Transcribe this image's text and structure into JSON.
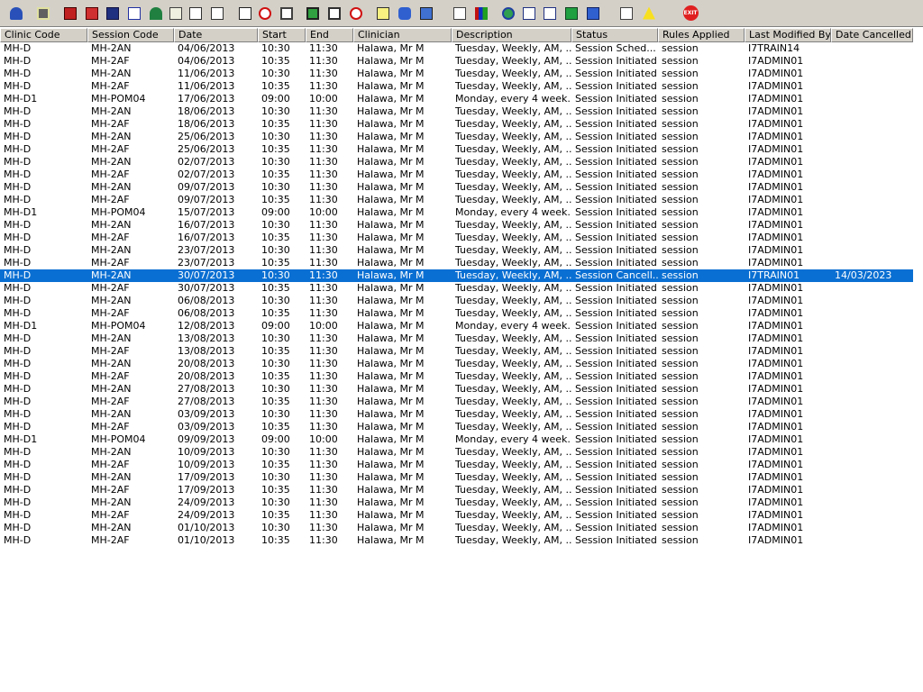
{
  "toolbar": {
    "icons": [
      "user-icon",
      "print-icon",
      "book-icon",
      "folder-icon",
      "report-icon",
      "m-icon",
      "person-icon",
      "notes-icon",
      "transfer-icon",
      "ticket-icon",
      "document-search-icon",
      "cancel-circle-icon",
      "window-icon",
      "monitor-icon",
      "list-icon",
      "clock-icon",
      "edit-icon",
      "car-icon",
      "upload-icon",
      "page-icon",
      "bar-chart-icon",
      "globe-icon",
      "check-list-icon",
      "check-list-2-icon",
      "export-icon",
      "import-icon",
      "swap-icon",
      "warning-icon",
      "exit-icon"
    ],
    "exit_label": "EXIT"
  },
  "columns": [
    "Clinic Code",
    "Session Code",
    "Date",
    "Start",
    "End",
    "Clinician",
    "Description",
    "Status",
    "Rules Applied",
    "Last Modified By",
    "Date Cancelled"
  ],
  "rows": [
    [
      "MH-D",
      "MH-2AN",
      "04/06/2013",
      "10:30",
      "11:30",
      "Halawa, Mr M",
      "Tuesday, Weekly, AM, ...",
      "Session Sched...",
      "session",
      "I7TRAIN14",
      ""
    ],
    [
      "MH-D",
      "MH-2AF",
      "04/06/2013",
      "10:35",
      "11:30",
      "Halawa, Mr M",
      "Tuesday, Weekly, AM, ...",
      "Session Initiated",
      "session",
      "I7ADMIN01",
      ""
    ],
    [
      "MH-D",
      "MH-2AN",
      "11/06/2013",
      "10:30",
      "11:30",
      "Halawa, Mr M",
      "Tuesday, Weekly, AM, ...",
      "Session Initiated",
      "session",
      "I7ADMIN01",
      ""
    ],
    [
      "MH-D",
      "MH-2AF",
      "11/06/2013",
      "10:35",
      "11:30",
      "Halawa, Mr M",
      "Tuesday, Weekly, AM, ...",
      "Session Initiated",
      "session",
      "I7ADMIN01",
      ""
    ],
    [
      "MH-D1",
      "MH-POM04",
      "17/06/2013",
      "09:00",
      "10:00",
      "Halawa, Mr M",
      "Monday, every 4 week...",
      "Session Initiated",
      "session",
      "I7ADMIN01",
      ""
    ],
    [
      "MH-D",
      "MH-2AN",
      "18/06/2013",
      "10:30",
      "11:30",
      "Halawa, Mr M",
      "Tuesday, Weekly, AM, ...",
      "Session Initiated",
      "session",
      "I7ADMIN01",
      ""
    ],
    [
      "MH-D",
      "MH-2AF",
      "18/06/2013",
      "10:35",
      "11:30",
      "Halawa, Mr M",
      "Tuesday, Weekly, AM, ...",
      "Session Initiated",
      "session",
      "I7ADMIN01",
      ""
    ],
    [
      "MH-D",
      "MH-2AN",
      "25/06/2013",
      "10:30",
      "11:30",
      "Halawa, Mr M",
      "Tuesday, Weekly, AM, ...",
      "Session Initiated",
      "session",
      "I7ADMIN01",
      ""
    ],
    [
      "MH-D",
      "MH-2AF",
      "25/06/2013",
      "10:35",
      "11:30",
      "Halawa, Mr M",
      "Tuesday, Weekly, AM, ...",
      "Session Initiated",
      "session",
      "I7ADMIN01",
      ""
    ],
    [
      "MH-D",
      "MH-2AN",
      "02/07/2013",
      "10:30",
      "11:30",
      "Halawa, Mr M",
      "Tuesday, Weekly, AM, ...",
      "Session Initiated",
      "session",
      "I7ADMIN01",
      ""
    ],
    [
      "MH-D",
      "MH-2AF",
      "02/07/2013",
      "10:35",
      "11:30",
      "Halawa, Mr M",
      "Tuesday, Weekly, AM, ...",
      "Session Initiated",
      "session",
      "I7ADMIN01",
      ""
    ],
    [
      "MH-D",
      "MH-2AN",
      "09/07/2013",
      "10:30",
      "11:30",
      "Halawa, Mr M",
      "Tuesday, Weekly, AM, ...",
      "Session Initiated",
      "session",
      "I7ADMIN01",
      ""
    ],
    [
      "MH-D",
      "MH-2AF",
      "09/07/2013",
      "10:35",
      "11:30",
      "Halawa, Mr M",
      "Tuesday, Weekly, AM, ...",
      "Session Initiated",
      "session",
      "I7ADMIN01",
      ""
    ],
    [
      "MH-D1",
      "MH-POM04",
      "15/07/2013",
      "09:00",
      "10:00",
      "Halawa, Mr M",
      "Monday, every 4 week...",
      "Session Initiated",
      "session",
      "I7ADMIN01",
      ""
    ],
    [
      "MH-D",
      "MH-2AN",
      "16/07/2013",
      "10:30",
      "11:30",
      "Halawa, Mr M",
      "Tuesday, Weekly, AM, ...",
      "Session Initiated",
      "session",
      "I7ADMIN01",
      ""
    ],
    [
      "MH-D",
      "MH-2AF",
      "16/07/2013",
      "10:35",
      "11:30",
      "Halawa, Mr M",
      "Tuesday, Weekly, AM, ...",
      "Session Initiated",
      "session",
      "I7ADMIN01",
      ""
    ],
    [
      "MH-D",
      "MH-2AN",
      "23/07/2013",
      "10:30",
      "11:30",
      "Halawa, Mr M",
      "Tuesday, Weekly, AM, ...",
      "Session Initiated",
      "session",
      "I7ADMIN01",
      ""
    ],
    [
      "MH-D",
      "MH-2AF",
      "23/07/2013",
      "10:35",
      "11:30",
      "Halawa, Mr M",
      "Tuesday, Weekly, AM, ...",
      "Session Initiated",
      "session",
      "I7ADMIN01",
      ""
    ],
    [
      "MH-D",
      "MH-2AN",
      "30/07/2013",
      "10:30",
      "11:30",
      "Halawa, Mr M",
      "Tuesday, Weekly, AM, ...",
      "Session Cancell...",
      "session",
      "I7TRAIN01",
      "14/03/2023"
    ],
    [
      "MH-D",
      "MH-2AF",
      "30/07/2013",
      "10:35",
      "11:30",
      "Halawa, Mr M",
      "Tuesday, Weekly, AM, ...",
      "Session Initiated",
      "session",
      "I7ADMIN01",
      ""
    ],
    [
      "MH-D",
      "MH-2AN",
      "06/08/2013",
      "10:30",
      "11:30",
      "Halawa, Mr M",
      "Tuesday, Weekly, AM, ...",
      "Session Initiated",
      "session",
      "I7ADMIN01",
      ""
    ],
    [
      "MH-D",
      "MH-2AF",
      "06/08/2013",
      "10:35",
      "11:30",
      "Halawa, Mr M",
      "Tuesday, Weekly, AM, ...",
      "Session Initiated",
      "session",
      "I7ADMIN01",
      ""
    ],
    [
      "MH-D1",
      "MH-POM04",
      "12/08/2013",
      "09:00",
      "10:00",
      "Halawa, Mr M",
      "Monday, every 4 week...",
      "Session Initiated",
      "session",
      "I7ADMIN01",
      ""
    ],
    [
      "MH-D",
      "MH-2AN",
      "13/08/2013",
      "10:30",
      "11:30",
      "Halawa, Mr M",
      "Tuesday, Weekly, AM, ...",
      "Session Initiated",
      "session",
      "I7ADMIN01",
      ""
    ],
    [
      "MH-D",
      "MH-2AF",
      "13/08/2013",
      "10:35",
      "11:30",
      "Halawa, Mr M",
      "Tuesday, Weekly, AM, ...",
      "Session Initiated",
      "session",
      "I7ADMIN01",
      ""
    ],
    [
      "MH-D",
      "MH-2AN",
      "20/08/2013",
      "10:30",
      "11:30",
      "Halawa, Mr M",
      "Tuesday, Weekly, AM, ...",
      "Session Initiated",
      "session",
      "I7ADMIN01",
      ""
    ],
    [
      "MH-D",
      "MH-2AF",
      "20/08/2013",
      "10:35",
      "11:30",
      "Halawa, Mr M",
      "Tuesday, Weekly, AM, ...",
      "Session Initiated",
      "session",
      "I7ADMIN01",
      ""
    ],
    [
      "MH-D",
      "MH-2AN",
      "27/08/2013",
      "10:30",
      "11:30",
      "Halawa, Mr M",
      "Tuesday, Weekly, AM, ...",
      "Session Initiated",
      "session",
      "I7ADMIN01",
      ""
    ],
    [
      "MH-D",
      "MH-2AF",
      "27/08/2013",
      "10:35",
      "11:30",
      "Halawa, Mr M",
      "Tuesday, Weekly, AM, ...",
      "Session Initiated",
      "session",
      "I7ADMIN01",
      ""
    ],
    [
      "MH-D",
      "MH-2AN",
      "03/09/2013",
      "10:30",
      "11:30",
      "Halawa, Mr M",
      "Tuesday, Weekly, AM, ...",
      "Session Initiated",
      "session",
      "I7ADMIN01",
      ""
    ],
    [
      "MH-D",
      "MH-2AF",
      "03/09/2013",
      "10:35",
      "11:30",
      "Halawa, Mr M",
      "Tuesday, Weekly, AM, ...",
      "Session Initiated",
      "session",
      "I7ADMIN01",
      ""
    ],
    [
      "MH-D1",
      "MH-POM04",
      "09/09/2013",
      "09:00",
      "10:00",
      "Halawa, Mr M",
      "Monday, every 4 week...",
      "Session Initiated",
      "session",
      "I7ADMIN01",
      ""
    ],
    [
      "MH-D",
      "MH-2AN",
      "10/09/2013",
      "10:30",
      "11:30",
      "Halawa, Mr M",
      "Tuesday, Weekly, AM, ...",
      "Session Initiated",
      "session",
      "I7ADMIN01",
      ""
    ],
    [
      "MH-D",
      "MH-2AF",
      "10/09/2013",
      "10:35",
      "11:30",
      "Halawa, Mr M",
      "Tuesday, Weekly, AM, ...",
      "Session Initiated",
      "session",
      "I7ADMIN01",
      ""
    ],
    [
      "MH-D",
      "MH-2AN",
      "17/09/2013",
      "10:30",
      "11:30",
      "Halawa, Mr M",
      "Tuesday, Weekly, AM, ...",
      "Session Initiated",
      "session",
      "I7ADMIN01",
      ""
    ],
    [
      "MH-D",
      "MH-2AF",
      "17/09/2013",
      "10:35",
      "11:30",
      "Halawa, Mr M",
      "Tuesday, Weekly, AM, ...",
      "Session Initiated",
      "session",
      "I7ADMIN01",
      ""
    ],
    [
      "MH-D",
      "MH-2AN",
      "24/09/2013",
      "10:30",
      "11:30",
      "Halawa, Mr M",
      "Tuesday, Weekly, AM, ...",
      "Session Initiated",
      "session",
      "I7ADMIN01",
      ""
    ],
    [
      "MH-D",
      "MH-2AF",
      "24/09/2013",
      "10:35",
      "11:30",
      "Halawa, Mr M",
      "Tuesday, Weekly, AM, ...",
      "Session Initiated",
      "session",
      "I7ADMIN01",
      ""
    ],
    [
      "MH-D",
      "MH-2AN",
      "01/10/2013",
      "10:30",
      "11:30",
      "Halawa, Mr M",
      "Tuesday, Weekly, AM, ...",
      "Session Initiated",
      "session",
      "I7ADMIN01",
      ""
    ],
    [
      "MH-D",
      "MH-2AF",
      "01/10/2013",
      "10:35",
      "11:30",
      "Halawa, Mr M",
      "Tuesday, Weekly, AM, ...",
      "Session Initiated",
      "session",
      "I7ADMIN01",
      ""
    ]
  ],
  "selected_row": 18,
  "colors": {
    "selection": "#0a6fd2",
    "toolbar": "#d4d0c8",
    "exit": "#e02020"
  }
}
